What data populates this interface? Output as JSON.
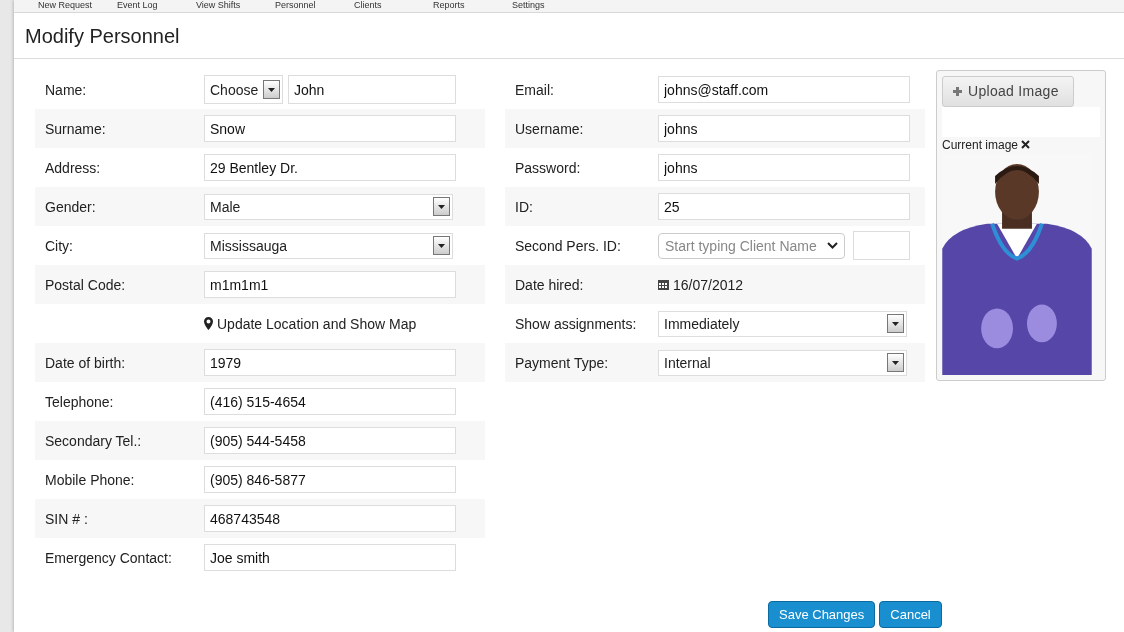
{
  "nav": [
    "New Request",
    "Event Log",
    "View Shifts",
    "Personnel",
    "Clients",
    "Reports",
    "Settings"
  ],
  "title": "Modify Personnel",
  "left_rows": [
    {
      "kind": "name",
      "label": "Name:",
      "choice": "Choose",
      "value": "John"
    },
    {
      "kind": "text",
      "label": "Surname:",
      "value": "Snow"
    },
    {
      "kind": "text",
      "label": "Address:",
      "value": "29 Bentley Dr."
    },
    {
      "kind": "select",
      "label": "Gender:",
      "value": "Male"
    },
    {
      "kind": "select",
      "label": "City:",
      "value": "Mississauga"
    },
    {
      "kind": "text",
      "label": "Postal Code:",
      "value": "m1m1m1"
    },
    {
      "kind": "link",
      "text": "Update Location and Show Map"
    },
    {
      "kind": "text",
      "label": "Date of birth:",
      "value": "1979"
    },
    {
      "kind": "text",
      "label": "Telephone:",
      "value": "(416) 515-4654"
    },
    {
      "kind": "text",
      "label": "Secondary Tel.:",
      "value": "(905) 544-5458"
    },
    {
      "kind": "text",
      "label": "Mobile Phone:",
      "value": "(905) 846-5877"
    },
    {
      "kind": "text",
      "label": "SIN # :",
      "value": "468743548"
    },
    {
      "kind": "text",
      "label": "Emergency Contact:",
      "value": "Joe smith"
    }
  ],
  "right_rows": [
    {
      "kind": "text",
      "label": "Email:",
      "value": "johns@staff.com"
    },
    {
      "kind": "text",
      "label": "Username:",
      "value": "johns"
    },
    {
      "kind": "text",
      "label": "Password:",
      "value": "johns"
    },
    {
      "kind": "text",
      "label": "ID:",
      "value": "25"
    },
    {
      "kind": "combo",
      "label": "Second Pers. ID:",
      "placeholder": "Start typing Client Name"
    },
    {
      "kind": "date",
      "label": "Date hired:",
      "value": "16/07/2012"
    },
    {
      "kind": "select",
      "label": "Show assignments:",
      "value": "Immediately"
    },
    {
      "kind": "select",
      "label": "Payment Type:",
      "value": "Internal"
    }
  ],
  "image_panel": {
    "upload_button": "Upload Image",
    "current_label": "Current image"
  },
  "buttons": [
    "Save Changes",
    "Cancel"
  ]
}
